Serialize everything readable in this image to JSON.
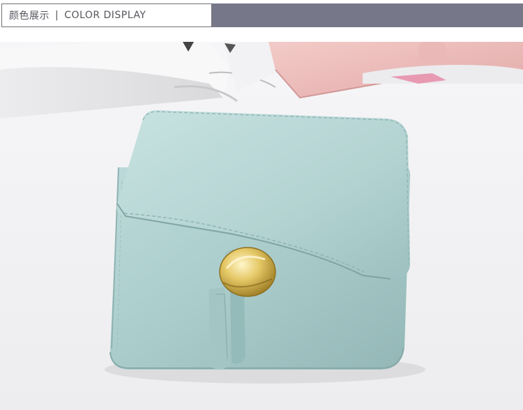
{
  "header": {
    "title_cn": "颜色展示",
    "separator": "|",
    "title_en": "COLOR DISPLAY"
  },
  "photo": {
    "subject": "wallet-icon",
    "colors": {
      "wallet": "#a9cccb",
      "clasp": "#d7b64a",
      "background": "#f1f1f3",
      "pink_wallet": "#eab8b7"
    }
  }
}
